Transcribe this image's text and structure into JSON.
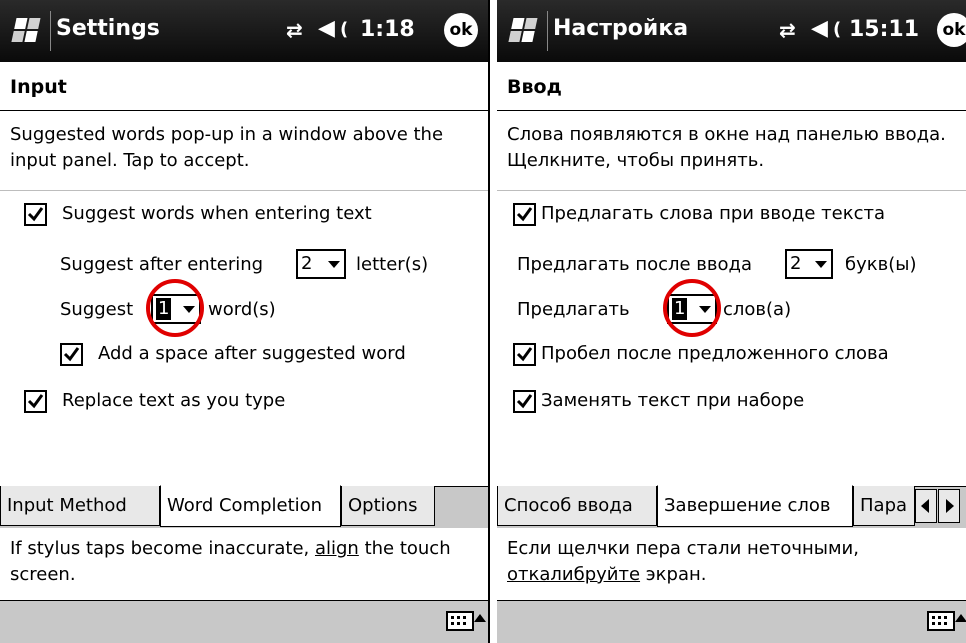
{
  "english": {
    "title": "Settings",
    "clock": "1:18",
    "ok": "ok",
    "header": "Input",
    "description": "Suggested words pop-up in a window above the input panel.  Tap to accept.",
    "suggest_words": {
      "label": "Suggest words when entering text",
      "checked": true
    },
    "suggest_after_label": "Suggest after entering",
    "suggest_after_value": "2",
    "letters_label": "letter(s)",
    "suggest_label": "Suggest",
    "suggest_value": "1",
    "words_label": "word(s)",
    "add_space": {
      "label": "Add a space after suggested word",
      "checked": true
    },
    "replace_text": {
      "label": "Replace text as you type",
      "checked": true
    },
    "tabs": [
      "Input Method",
      "Word Completion",
      "Options"
    ],
    "active_tab": "Word Completion",
    "footer_before": "If stylus taps become inaccurate, ",
    "footer_link": "align",
    "footer_after": " the touch screen."
  },
  "russian": {
    "title": "Настройка",
    "clock": "15:11",
    "ok": "ok",
    "header": "Ввод",
    "description": "Слова появляются в окне над панелью ввода. Щелкните, чтобы принять.",
    "suggest_words": {
      "label": "Предлагать слова при вводе текста",
      "checked": true
    },
    "suggest_after_label": "Предлагать после ввода",
    "suggest_after_value": "2",
    "letters_label": "букв(ы)",
    "suggest_label": "Предлагать",
    "suggest_value": "1",
    "words_label": "слов(а)",
    "add_space": {
      "label": "Пробел после предложенного слова",
      "checked": true
    },
    "replace_text": {
      "label": "Заменять текст при наборе",
      "checked": true
    },
    "tabs": [
      "Способ ввода",
      "Завершение слов",
      "Пара"
    ],
    "active_tab": "Завершение слов",
    "footer_before": "Если щелчки пера стали неточными, ",
    "footer_link": "откалибруйте",
    "footer_after": " экран."
  },
  "colors": {
    "titlebar": "#111111",
    "highlight_ring": "#e00000",
    "tab_strip": "#c8c8c8"
  },
  "icons": [
    "windows-start-icon",
    "connectivity-icon",
    "volume-icon",
    "keyboard-icon",
    "sip-arrow-icon"
  ]
}
